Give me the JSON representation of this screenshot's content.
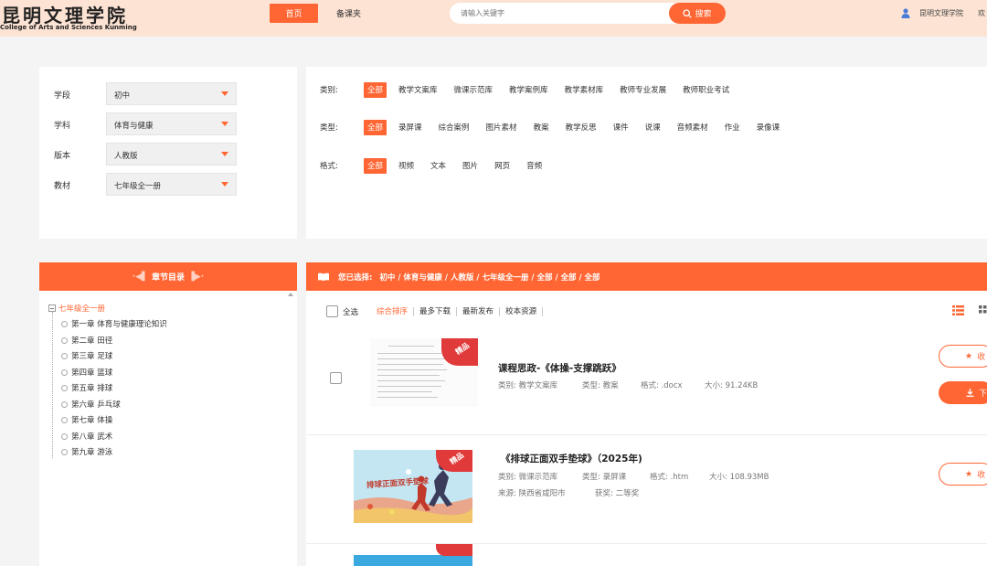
{
  "header": {
    "logo_cn": "昆明文理学院",
    "logo_en": "College of Arts and Sciences Kunming",
    "nav": {
      "home": "首页",
      "prep": "备课夹"
    },
    "search": {
      "placeholder": "请输入关键字",
      "button": "搜索"
    },
    "user": {
      "name": "昆明文理学院",
      "extra": "欢"
    }
  },
  "filters": {
    "selects": [
      {
        "label": "学段",
        "value": "初中"
      },
      {
        "label": "学科",
        "value": "体育与健康"
      },
      {
        "label": "版本",
        "value": "人教版"
      },
      {
        "label": "教材",
        "value": "七年级全一册"
      }
    ],
    "category": {
      "label": "类别:",
      "all": "全部",
      "items": [
        "教学文案库",
        "微课示范库",
        "教学案例库",
        "教学素材库",
        "教师专业发展",
        "教师职业考试"
      ]
    },
    "type": {
      "label": "类型:",
      "all": "全部",
      "items": [
        "录屏课",
        "综合案例",
        "图片素材",
        "教案",
        "教学反思",
        "课件",
        "说课",
        "音频素材",
        "作业",
        "录像课"
      ]
    },
    "format": {
      "label": "格式:",
      "all": "全部",
      "items": [
        "视频",
        "文本",
        "图片",
        "网页",
        "音频"
      ]
    }
  },
  "chapters": {
    "title": "章节目录",
    "root": "七年级全一册",
    "items": [
      "第一章 体育与健康理论知识",
      "第二章 田径",
      "第三章 足球",
      "第四章 篮球",
      "第五章 排球",
      "第六章 乒乓球",
      "第七章 体操",
      "第八章 武术",
      "第九章 游泳"
    ]
  },
  "results": {
    "selected_label": "您已选择:",
    "selected_path": "初中 / 体育与健康 / 人教版 / 七年级全一册 / 全部 / 全部 / 全部",
    "sort": {
      "select_all": "全选",
      "items": [
        "综合排序",
        "最多下载",
        "最新发布",
        "校本资源"
      ]
    },
    "badge": "精品",
    "fav_label": "收",
    "dl_label": "下",
    "list": [
      {
        "title": "课程思政-《体操-支撑跳跃》",
        "category": "类别: 教学文案库",
        "type": "类型: 教案",
        "format": "格式: .docx",
        "size": "大小: 91.24KB"
      },
      {
        "title": "《排球正面双手垫球》（2025年)",
        "thumb_text": "排球正面双手垫球",
        "category": "类别: 微课示范库",
        "type": "类型: 录屏课",
        "format": "格式: .htm",
        "size": "大小: 108.93MB",
        "source": "来源: 陕西省咸阳市",
        "award": "获奖: 二等奖"
      }
    ]
  },
  "colors": {
    "accent": "#ff6633",
    "header_bg": "#fde3d3",
    "badge": "#e03a3a"
  }
}
